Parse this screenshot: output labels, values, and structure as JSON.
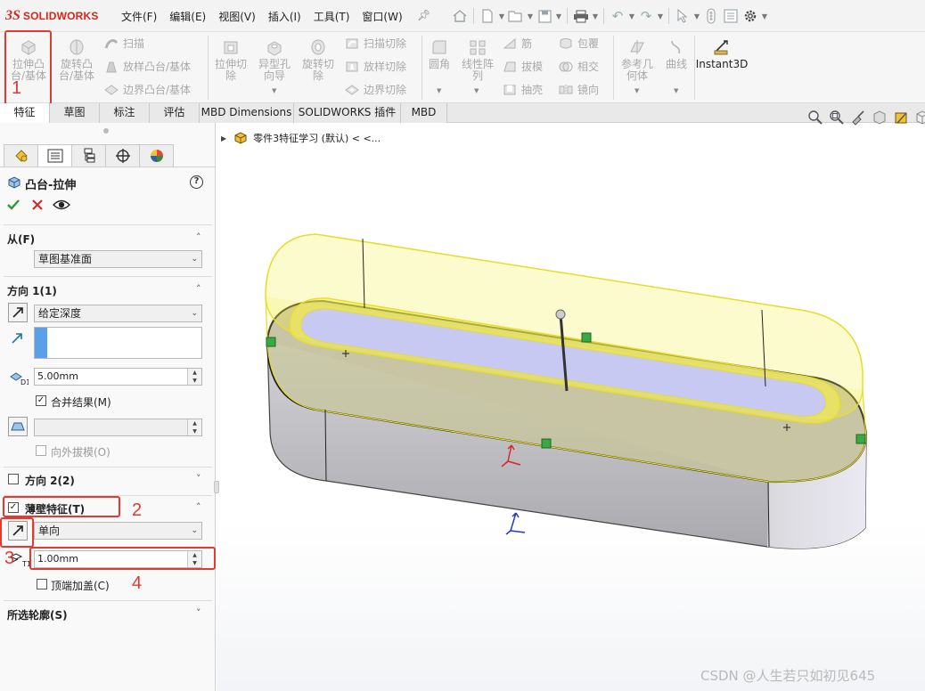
{
  "app": {
    "logo_mark": "3S",
    "logo_text": "SOLIDWORKS"
  },
  "menu": [
    "文件(F)",
    "编辑(E)",
    "视图(V)",
    "插入(I)",
    "工具(T)",
    "窗口(W)"
  ],
  "quick_access_icons": [
    "home-icon",
    "new-file-icon",
    "open-icon",
    "save-icon",
    "print-icon",
    "undo-icon",
    "redo-icon",
    "select-icon",
    "traffic-light-icon",
    "file-properties-icon",
    "options-gear-icon"
  ],
  "ribbon": {
    "extrude_boss_l1": "拉伸凸",
    "extrude_boss_l2": "台/基体",
    "revolve_boss_l1": "旋转凸",
    "revolve_boss_l2": "台/基体",
    "sweep_boss": "扫描",
    "loft_boss": "放样凸台/基体",
    "boundary_boss": "边界凸台/基体",
    "extrude_cut_l1": "拉伸切",
    "extrude_cut_l2": "除",
    "hole_wizard_l1": "异型孔",
    "hole_wizard_l2": "向导",
    "revolve_cut_l1": "旋转切",
    "revolve_cut_l2": "除",
    "sweep_cut": "扫描切除",
    "loft_cut": "放样切除",
    "boundary_cut": "边界切除",
    "fillet": "圆角",
    "linear_pattern_l1": "线性阵",
    "linear_pattern_l2": "列",
    "rib": "筋",
    "draft": "拔模",
    "shell": "抽壳",
    "wrap": "包覆",
    "intersect": "相交",
    "mirror": "镜向",
    "ref_geom_l1": "参考几",
    "ref_geom_l2": "何体",
    "curves": "曲线",
    "instant3d": "Instant3D"
  },
  "tabs": [
    "特征",
    "草图",
    "标注",
    "评估",
    "MBD Dimensions",
    "SOLIDWORKS 插件",
    "MBD"
  ],
  "tree": {
    "part_name": "零件3特征学习 (默认) < <..."
  },
  "panel": {
    "title": "凸台-拉伸",
    "from": {
      "label": "从(F)",
      "value": "草图基准面"
    },
    "direction1": {
      "label": "方向 1(1)",
      "end_condition": "给定深度",
      "depth": "5.00mm",
      "merge_result": "合并结果(M)",
      "merge_checked": true,
      "draft_outward": "向外拔模(O)"
    },
    "direction2": {
      "label": "方向 2(2)"
    },
    "thin_feature": {
      "label": "薄壁特征(T)",
      "checked": true,
      "type": "单向",
      "thickness": "1.00mm",
      "cap_ends": "顶端加盖(C)"
    },
    "selected_contours": {
      "label": "所选轮廓(S)"
    }
  },
  "annotations": [
    "1",
    "2",
    "3",
    "4"
  ],
  "watermark": "CSDN @人生若只如初见645",
  "colors": {
    "logo_red": "#d5281d",
    "annotation_red": "#e23a2e",
    "preview_yellow": "#f6f04a",
    "model_gray": "#b9b9bd",
    "cap_blue": "#c8c9f2"
  }
}
